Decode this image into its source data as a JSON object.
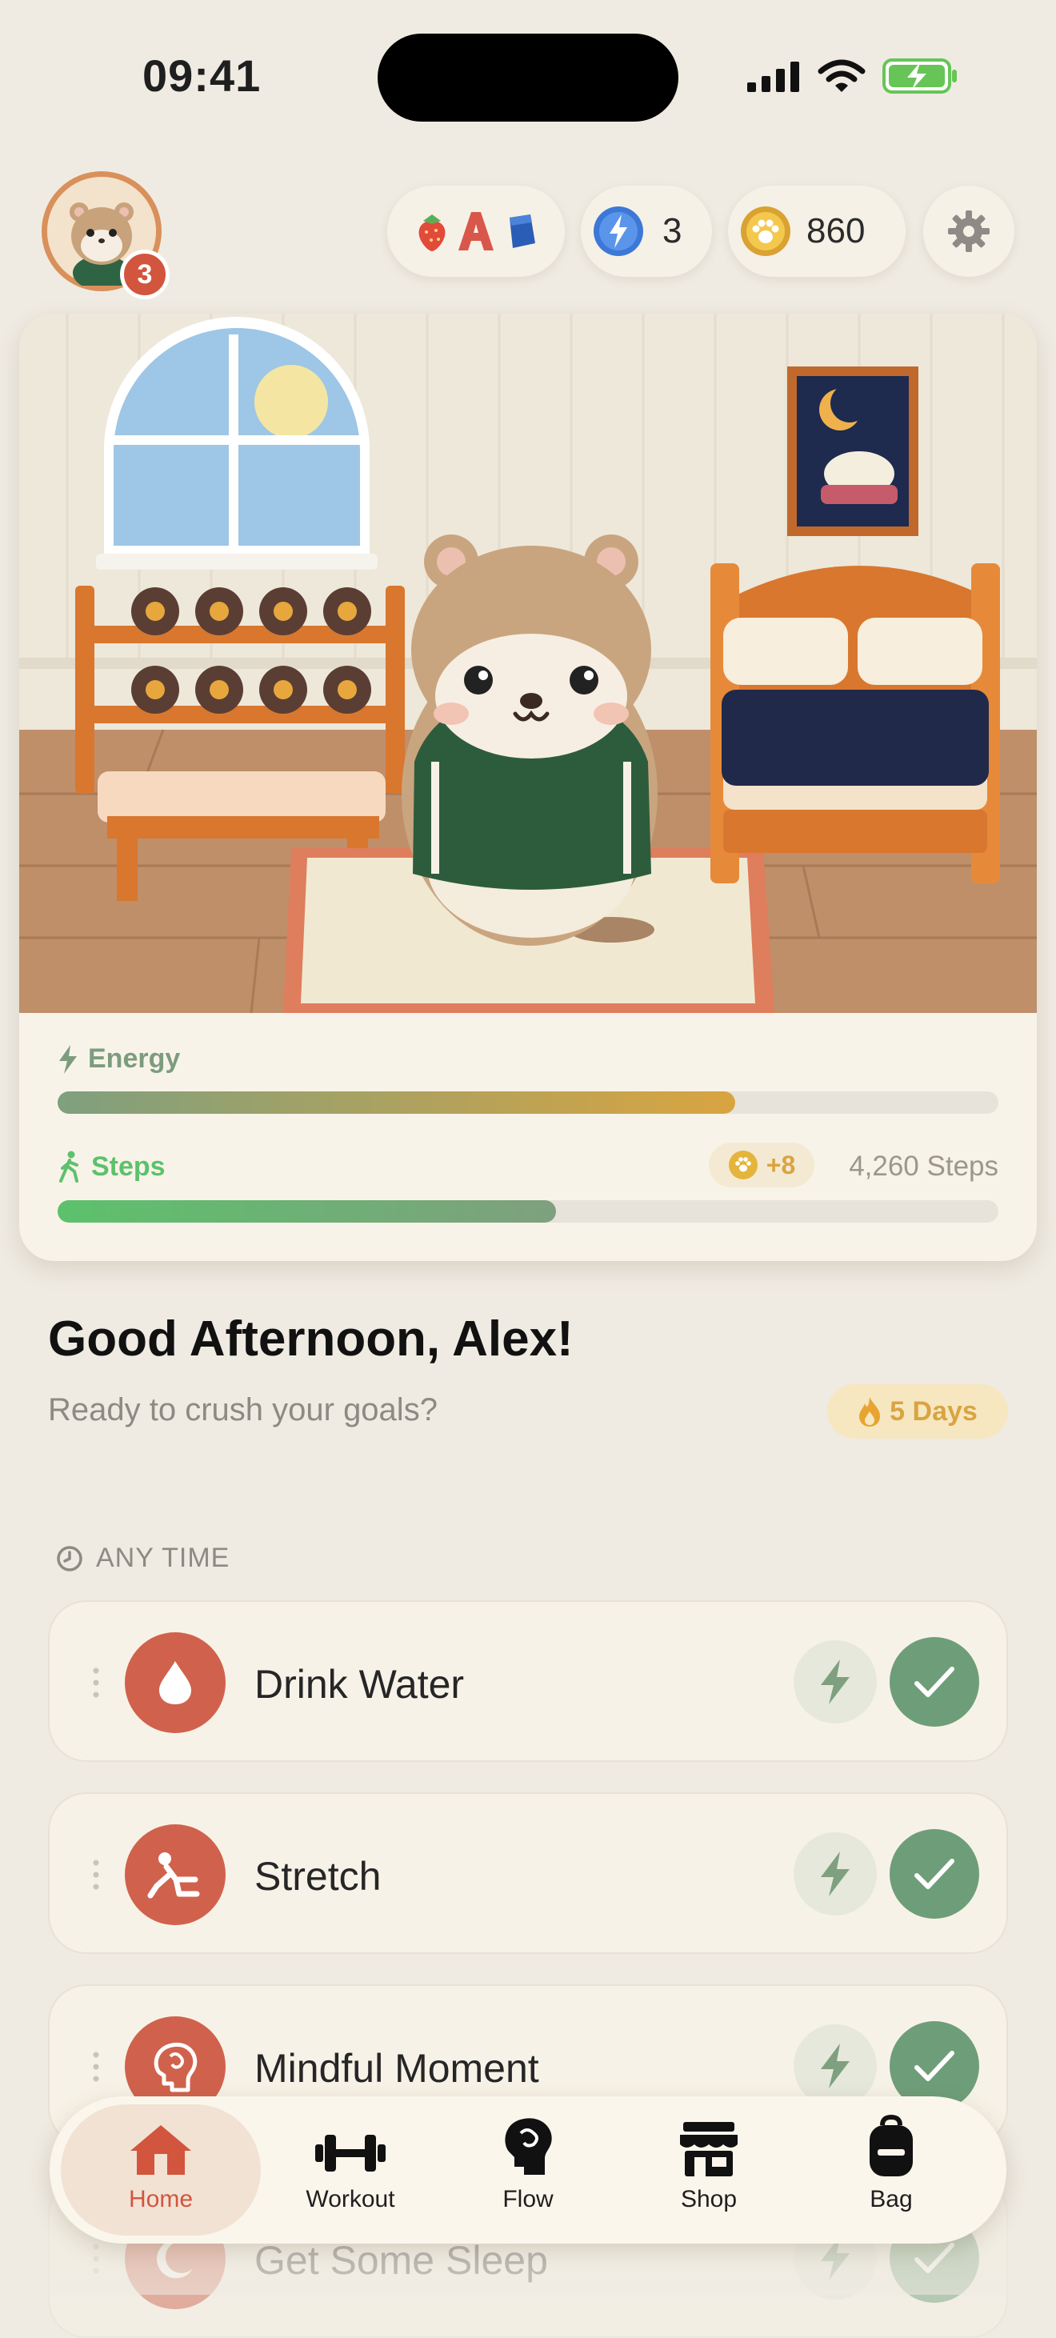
{
  "status_bar": {
    "time": "09:41"
  },
  "header": {
    "avatar_badge": "3",
    "bolt_count": "3",
    "coin_count": "860"
  },
  "stats": {
    "energy": {
      "label": "Energy",
      "level": 0.72
    },
    "steps": {
      "label": "Steps",
      "bonus": "+8",
      "count": "4,260 Steps",
      "level": 0.53
    }
  },
  "greeting": {
    "title": "Good Afternoon, Alex!",
    "subtitle": "Ready to crush your goals?",
    "streak": "5 Days"
  },
  "section": {
    "label": "ANY TIME"
  },
  "habits": [
    {
      "name": "Drink Water",
      "icon": "water-drop-icon"
    },
    {
      "name": "Stretch",
      "icon": "stretch-icon"
    },
    {
      "name": "Mindful Moment",
      "icon": "brain-icon"
    },
    {
      "name": "Get Some Sleep",
      "icon": "moon-icon"
    }
  ],
  "nav": {
    "items": [
      {
        "label": "Home",
        "icon": "home-icon",
        "active": true
      },
      {
        "label": "Workout",
        "icon": "dumbbell-icon"
      },
      {
        "label": "Flow",
        "icon": "brain-head-icon"
      },
      {
        "label": "Shop",
        "icon": "shop-icon"
      },
      {
        "label": "Bag",
        "icon": "backpack-icon"
      }
    ]
  },
  "colors": {
    "background": "#EFEBE2",
    "accent_red": "#D2553E",
    "check_green": "#6E9E79",
    "energy_gold": "#D9A441",
    "steps_green": "#5CC16C"
  }
}
